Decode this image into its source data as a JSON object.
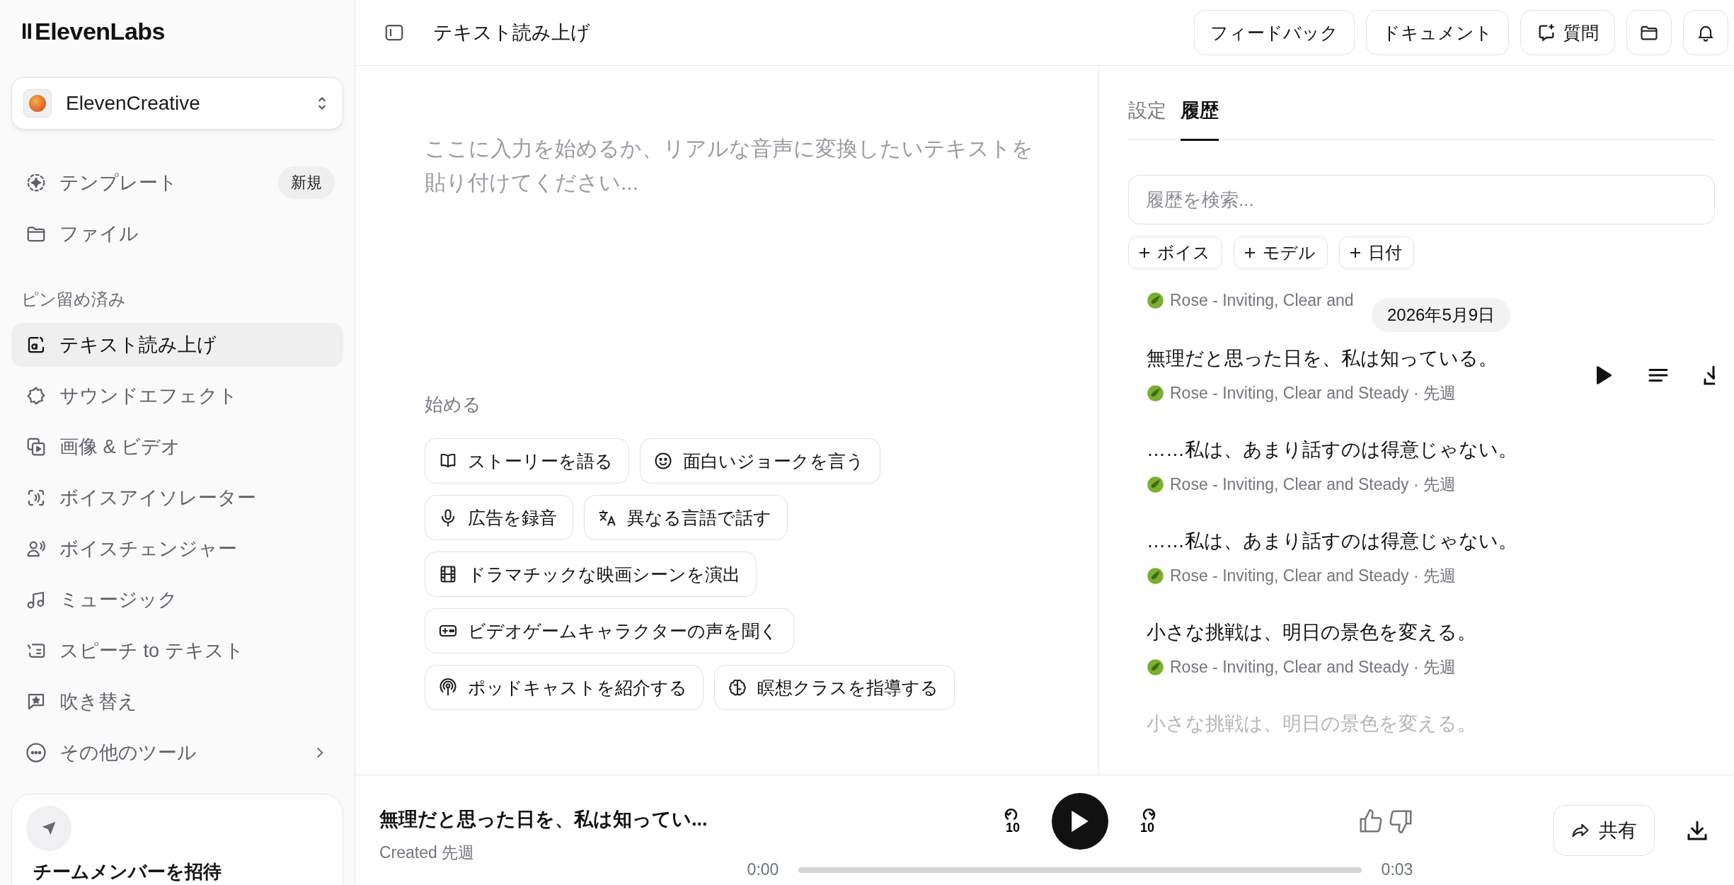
{
  "logo": {
    "text": "ElevenLabs"
  },
  "workspace": {
    "name": "ElevenCreative"
  },
  "sidebar": {
    "items": [
      {
        "label": "テンプレート",
        "selected": false,
        "badge": "新規"
      },
      {
        "label": "ファイル",
        "selected": false
      }
    ],
    "pinned_heading": "ピン留め済み",
    "pinned_items": [
      {
        "label": "テキスト読み上げ",
        "selected": true
      },
      {
        "label": "サウンドエフェクト",
        "selected": false
      },
      {
        "label": "画像 & ビデオ",
        "selected": false
      },
      {
        "label": "ボイスアイソレーター",
        "selected": false
      },
      {
        "label": "ボイスチェンジャー",
        "selected": false
      },
      {
        "label": "ミュージック",
        "selected": false
      },
      {
        "label": "スピーチ to テキスト",
        "selected": false
      },
      {
        "label": "吹き替え",
        "selected": false
      },
      {
        "label": "その他のツール",
        "selected": false,
        "has_submenu": true
      }
    ],
    "invite": {
      "title": "チームメンバーを招待"
    }
  },
  "topbar": {
    "title": "テキスト読み上げ",
    "buttons": [
      {
        "label": "フィードバック",
        "kind": "plain"
      },
      {
        "label": "ドキュメント",
        "kind": "plain"
      },
      {
        "label": "質問",
        "kind": "ask"
      }
    ]
  },
  "editor": {
    "placeholder": "ここに入力を始めるか、リアルな音声に変換したいテキストを貼り付けてください...",
    "start_heading": "始める",
    "chip_rows": [
      [
        "ストーリーを語る",
        "面白いジョークを言う"
      ],
      [
        "広告を録音",
        "異なる言語で話す"
      ],
      [
        "ドラマチックな映画シーンを演出"
      ],
      [
        "ビデオゲームキャラクターの声を聞く"
      ],
      [
        "ポッドキャストを紹介する",
        "瞑想クラスを指導する"
      ]
    ]
  },
  "history_panel": {
    "tabs": [
      {
        "label": "設定",
        "selected": false
      },
      {
        "label": "履歴",
        "selected": true
      }
    ],
    "search": {
      "placeholder": "履歴を検索..."
    },
    "filters": [
      "ボイス",
      "モデル",
      "日付"
    ],
    "partial_meta": "Rose - Inviting, Clear and",
    "date_badge": "2026年5月9日",
    "items": [
      {
        "title": "無理だと思った日を、私は知っている。",
        "meta": "Rose - Inviting, Clear and Steady · 先週",
        "hovered": true,
        "faded": false
      },
      {
        "title": "……私は、あまり話すのは得意じゃない。",
        "meta": "Rose - Inviting, Clear and Steady · 先週",
        "hovered": false,
        "faded": false
      },
      {
        "title": "……私は、あまり話すのは得意じゃない。",
        "meta": "Rose - Inviting, Clear and Steady · 先週",
        "hovered": false,
        "faded": false
      },
      {
        "title": "小さな挑戦は、明日の景色を変える。",
        "meta": "Rose - Inviting, Clear and Steady · 先週",
        "hovered": false,
        "faded": false
      },
      {
        "title": "小さな挑戦は、明日の景色を変える。",
        "hovered": false,
        "faded": true
      }
    ]
  },
  "player": {
    "title": "無理だと思った日を、私は知ってい...",
    "subtitle": "Created 先週",
    "skip_back": "10",
    "skip_forward": "10",
    "elapsed": "0:00",
    "duration": "0:03",
    "level": 0,
    "share": "共有"
  }
}
